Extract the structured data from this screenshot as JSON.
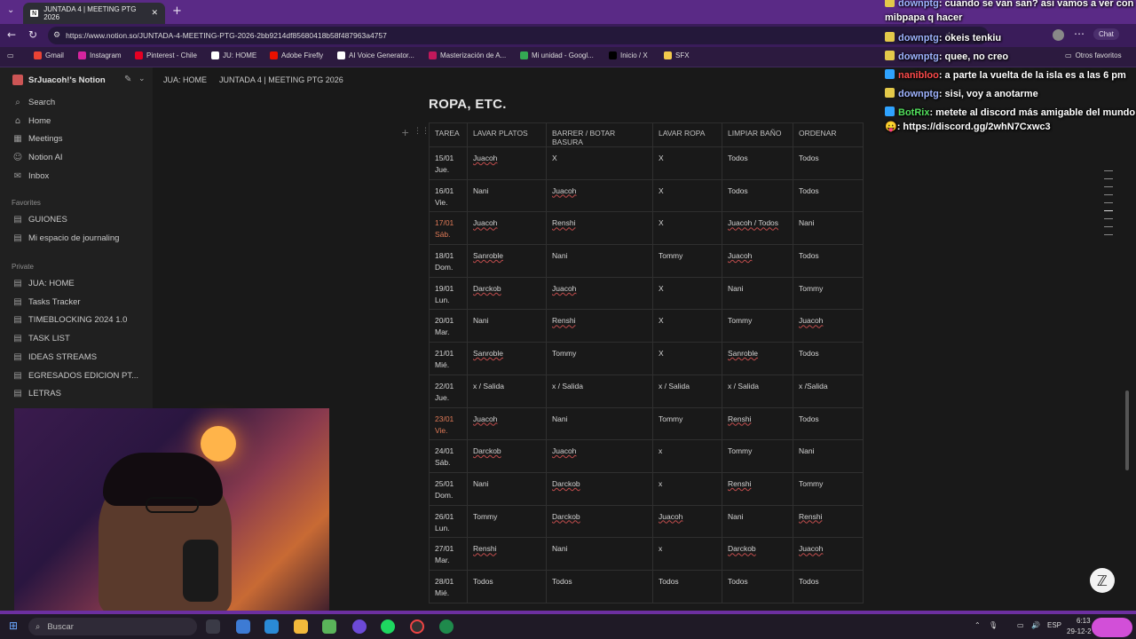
{
  "browser": {
    "tabs": [
      {
        "label": "JUNTADA 4 | MEETING PTG 2026"
      }
    ],
    "url": "https://www.notion.so/JUNTADA-4-MEETING-PTG-2026-2bb9214df85680418b58f487963a4757",
    "right": {
      "other_favorites": "Otros favoritos",
      "chat": "Chat"
    },
    "bookmarks": [
      {
        "label": "Gmail",
        "color": "#ea4335"
      },
      {
        "label": "Instagram",
        "color": "#d6249f"
      },
      {
        "label": "Pinterest - Chile",
        "color": "#e60023"
      },
      {
        "label": "JU: HOME",
        "color": "#ffffff"
      },
      {
        "label": "Adobe Firefly",
        "color": "#eb1000"
      },
      {
        "label": "AI Voice Generator...",
        "color": "#ffffff"
      },
      {
        "label": "Masterización de A...",
        "color": "#c2185b"
      },
      {
        "label": "Mi unidad - Googl...",
        "color": "#34a853"
      },
      {
        "label": "Inicio / X",
        "color": "#000000"
      },
      {
        "label": "SFX",
        "color": "#f2c94c"
      }
    ]
  },
  "sidebar": {
    "workspace": "SrJuacoh!'s Notion",
    "nav": [
      {
        "label": "Search",
        "icon": "search-icon"
      },
      {
        "label": "Home",
        "icon": "home-icon"
      },
      {
        "label": "Meetings",
        "icon": "calendar-icon"
      },
      {
        "label": "Notion AI",
        "icon": "notion-ai-icon"
      },
      {
        "label": "Inbox",
        "icon": "inbox-icon"
      }
    ],
    "favorites_heading": "Favorites",
    "favorites": [
      {
        "label": "GUIONES"
      },
      {
        "label": "Mi espacio de journaling"
      }
    ],
    "private_heading": "Private",
    "private": [
      {
        "label": "JUA: HOME"
      },
      {
        "label": "Tasks Tracker"
      },
      {
        "label": "TIMEBLOCKING 2024 1.0"
      },
      {
        "label": "TASK LIST"
      },
      {
        "label": "IDEAS STREAMS"
      },
      {
        "label": "EGRESADOS EDICION PT..."
      },
      {
        "label": "LETRAS"
      }
    ]
  },
  "breadcrumb": [
    "JUA: HOME",
    "JUNTADA 4 | MEETING PTG 2026"
  ],
  "page": {
    "section_title": "ROPA, ETC."
  },
  "table": {
    "headers": [
      "TAREA",
      "LAVAR PLATOS",
      "BARRER / BOTAR BASURA",
      "LAVAR ROPA",
      "LIMPIAR BAÑO",
      "ORDENAR"
    ],
    "rows": [
      {
        "date": "15/01",
        "day": "Jue.",
        "weekend": false,
        "cells": [
          "Juacoh",
          "X",
          "X",
          "Todos",
          "Todos"
        ]
      },
      {
        "date": "16/01",
        "day": "Vie.",
        "weekend": false,
        "cells": [
          "Nani",
          "Juacoh",
          "X",
          "Todos",
          "Todos"
        ]
      },
      {
        "date": "17/01",
        "day": "Sáb.",
        "weekend": true,
        "cells": [
          "Juacoh",
          "Renshi",
          "X",
          "Juacoh / Todos",
          "Nani"
        ]
      },
      {
        "date": "18/01",
        "day": "Dom.",
        "weekend": false,
        "cells": [
          "Sanroble",
          "Nani",
          "Tommy",
          "Juacoh",
          "Todos"
        ]
      },
      {
        "date": "19/01",
        "day": "Lun.",
        "weekend": false,
        "cells": [
          "Darckob",
          "Juacoh",
          "X",
          "Nani",
          "Tommy"
        ]
      },
      {
        "date": "20/01",
        "day": "Mar.",
        "weekend": false,
        "cells": [
          "Nani",
          "Renshi",
          "X",
          "Tommy",
          "Juacoh"
        ]
      },
      {
        "date": "21/01",
        "day": "Mié.",
        "weekend": false,
        "cells": [
          "Sanroble",
          "Tommy",
          "X",
          "Sanroble",
          "Todos"
        ]
      },
      {
        "date": "22/01",
        "day": "Jue.",
        "weekend": false,
        "cells": [
          "x / Salida",
          "x / Salida",
          "x / Salida",
          "x / Salida",
          "x /Salida"
        ]
      },
      {
        "date": "23/01",
        "day": "Vie.",
        "weekend": true,
        "cells": [
          "Juacoh",
          "Nani",
          "Tommy",
          "Renshi",
          "Todos"
        ]
      },
      {
        "date": "24/01",
        "day": "Sáb.",
        "weekend": false,
        "cells": [
          "Darckob",
          "Juacoh",
          "x",
          "Tommy",
          "Nani"
        ]
      },
      {
        "date": "25/01",
        "day": "Dom.",
        "weekend": false,
        "cells": [
          "Nani",
          "Darckob",
          "x",
          "Renshi",
          "Tommy"
        ]
      },
      {
        "date": "26/01",
        "day": "Lun.",
        "weekend": false,
        "cells": [
          "Tommy",
          "Darckob",
          "Juacoh",
          "Nani",
          "Renshi"
        ]
      },
      {
        "date": "27/01",
        "day": "Mar.",
        "weekend": false,
        "cells": [
          "Renshi",
          "Nani",
          "x",
          "Darckob",
          "Juacoh"
        ]
      },
      {
        "date": "28/01",
        "day": "Mié.",
        "weekend": false,
        "cells": [
          "Todos",
          "Todos",
          "Todos",
          "Todos",
          "Todos"
        ]
      }
    ]
  },
  "chat": [
    {
      "user": "downptg",
      "user_color": "#9fb4ff",
      "message": ": cuando se van san? asi vamos a ver con mibpapa q hacer"
    },
    {
      "user": "downptg",
      "user_color": "#9fb4ff",
      "message": ": okeis tenkiu"
    },
    {
      "user": "downptg",
      "user_color": "#9fb4ff",
      "message": ": quee, no creo"
    },
    {
      "user": "nanibloo",
      "user_color": "#ff4b4b",
      "message": ": a parte la vuelta de la isla es a las 6 pm"
    },
    {
      "user": "downptg",
      "user_color": "#9fb4ff",
      "message": ": sisi, voy a anotarme"
    },
    {
      "user": "BotRix",
      "user_color": "#52e05c",
      "message": ": metete al discord más amigable del mundo😛: https://discord.gg/2whN7Cxwc3"
    }
  ],
  "taskbar": {
    "search_placeholder": "Buscar",
    "lang": "ESP",
    "time": "6:13",
    "date": "29-12-2"
  }
}
